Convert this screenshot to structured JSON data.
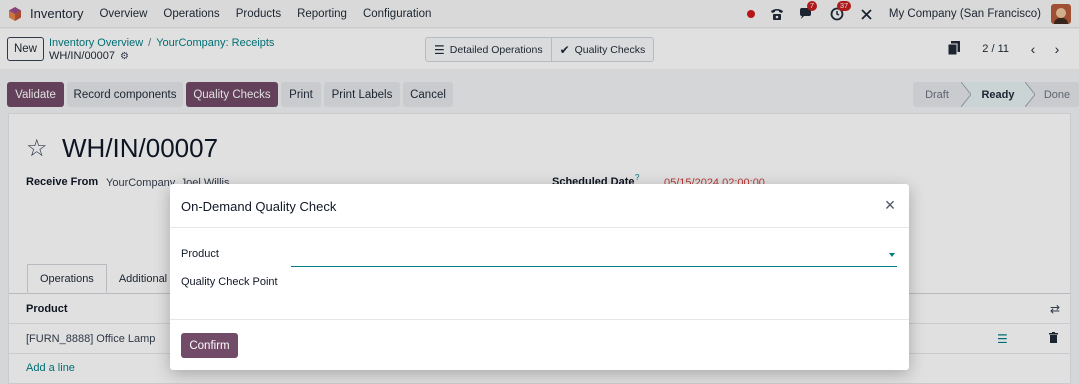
{
  "topnav": {
    "app_name": "Inventory",
    "menu": [
      "Overview",
      "Operations",
      "Products",
      "Reporting",
      "Configuration"
    ],
    "chat_count": "7",
    "activity_count": "37",
    "company": "My Company (San Francisco)"
  },
  "control": {
    "new_label": "New",
    "breadcrumbs": [
      "Inventory Overview",
      "YourCompany: Receipts"
    ],
    "record_name": "WH/IN/00007",
    "smart_buttons": [
      "Detailed Operations",
      "Quality Checks"
    ],
    "pager": "2 / 11"
  },
  "actions": {
    "validate": "Validate",
    "record_components": "Record components",
    "quality_checks": "Quality Checks",
    "print": "Print",
    "print_labels": "Print Labels",
    "cancel": "Cancel"
  },
  "status": {
    "stages": [
      "Draft",
      "Ready",
      "Done"
    ],
    "active": "Ready"
  },
  "form": {
    "title": "WH/IN/00007",
    "receive_from_label": "Receive From",
    "receive_from_value": "YourCompany, Joel Willis",
    "scheduled_date_label": "Scheduled Date",
    "scheduled_date_help": "?",
    "scheduled_date_value": "05/15/2024 02:00:00",
    "tabs": [
      "Operations",
      "Additional"
    ],
    "table_header_product": "Product",
    "row_product": "[FURN_8888] Office Lamp",
    "add_line": "Add a line"
  },
  "modal": {
    "title": "On-Demand Quality Check",
    "product_label": "Product",
    "product_value": "",
    "quality_check_point_label": "Quality Check Point",
    "confirm": "Confirm"
  },
  "colors": {
    "primary": "#714b67",
    "link": "#017e84",
    "badge": "#c81e1e",
    "date_red": "#d13f3f"
  }
}
